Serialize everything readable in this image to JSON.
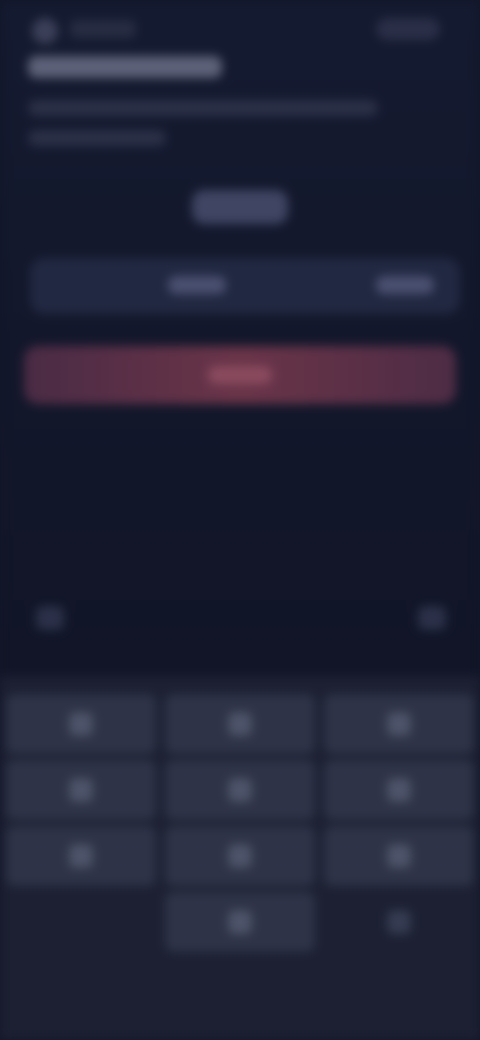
{
  "icons": {
    "app_logo": "logo-icon",
    "keypad_left": "collapse-icon",
    "keypad_right": "check-icon",
    "backspace": "backspace-icon"
  },
  "colors": {
    "background": "#121628",
    "primary_button": "#6a3448",
    "keypad_background": "#1c2032",
    "key_background": "#2e3347"
  }
}
